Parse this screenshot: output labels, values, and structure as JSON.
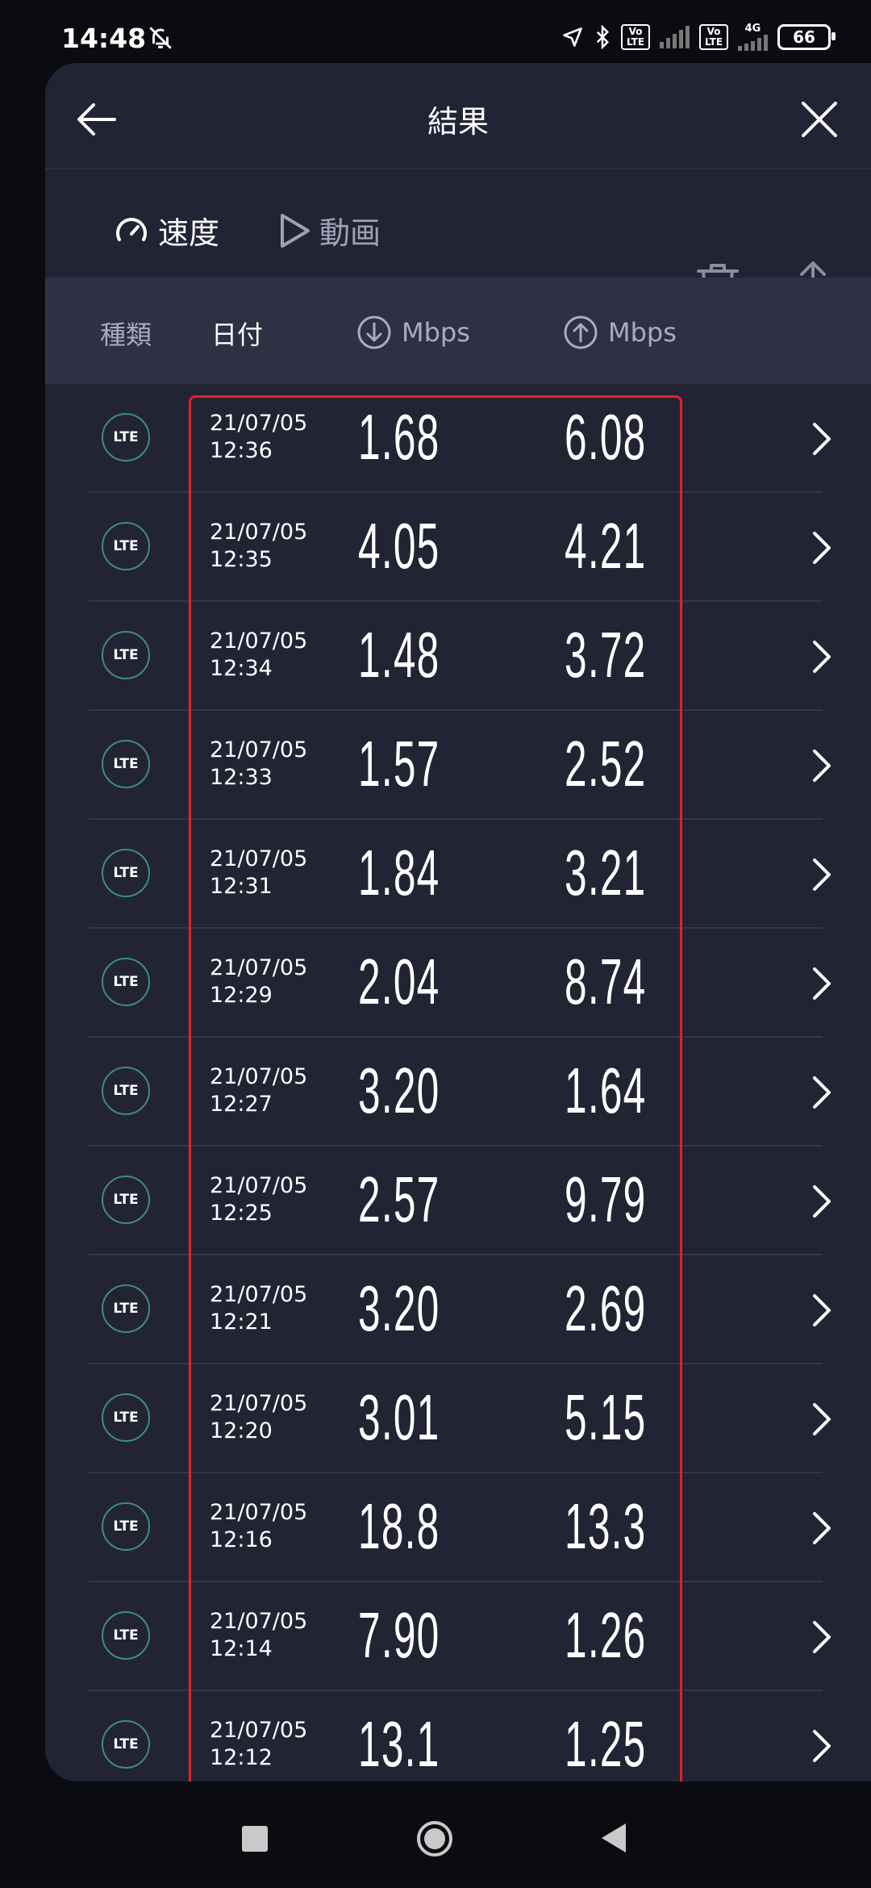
{
  "status_bar": {
    "time": "14:48",
    "volte_badge_1": "Vo LTE",
    "volte_badge_2": "Vo LTE",
    "network": "4G",
    "battery": "66"
  },
  "header": {
    "title": "結果"
  },
  "tabs": [
    {
      "label": "速度",
      "icon": "speedometer-icon",
      "active": true
    },
    {
      "label": "動画",
      "icon": "play-icon",
      "active": false
    }
  ],
  "columns": {
    "type": "種類",
    "date": "日付",
    "download": "Mbps",
    "upload": "Mbps"
  },
  "results": [
    {
      "type": "LTE",
      "date": "21/07/05",
      "time": "12:36",
      "down": "1.68",
      "up": "6.08"
    },
    {
      "type": "LTE",
      "date": "21/07/05",
      "time": "12:35",
      "down": "4.05",
      "up": "4.21"
    },
    {
      "type": "LTE",
      "date": "21/07/05",
      "time": "12:34",
      "down": "1.48",
      "up": "3.72"
    },
    {
      "type": "LTE",
      "date": "21/07/05",
      "time": "12:33",
      "down": "1.57",
      "up": "2.52"
    },
    {
      "type": "LTE",
      "date": "21/07/05",
      "time": "12:31",
      "down": "1.84",
      "up": "3.21"
    },
    {
      "type": "LTE",
      "date": "21/07/05",
      "time": "12:29",
      "down": "2.04",
      "up": "8.74"
    },
    {
      "type": "LTE",
      "date": "21/07/05",
      "time": "12:27",
      "down": "3.20",
      "up": "1.64"
    },
    {
      "type": "LTE",
      "date": "21/07/05",
      "time": "12:25",
      "down": "2.57",
      "up": "9.79"
    },
    {
      "type": "LTE",
      "date": "21/07/05",
      "time": "12:21",
      "down": "3.20",
      "up": "2.69"
    },
    {
      "type": "LTE",
      "date": "21/07/05",
      "time": "12:20",
      "down": "3.01",
      "up": "5.15"
    },
    {
      "type": "LTE",
      "date": "21/07/05",
      "time": "12:16",
      "down": "18.8",
      "up": "13.3"
    },
    {
      "type": "LTE",
      "date": "21/07/05",
      "time": "12:14",
      "down": "7.90",
      "up": "1.26"
    },
    {
      "type": "LTE",
      "date": "21/07/05",
      "time": "12:12",
      "down": "13.1",
      "up": "1.25"
    }
  ],
  "colors": {
    "panel_bg": "#222434",
    "column_header_bg": "#2e3144",
    "accent": "#2fb6e6",
    "highlight_box": "#e3202b",
    "lte_ring": "#3e8b8a"
  }
}
